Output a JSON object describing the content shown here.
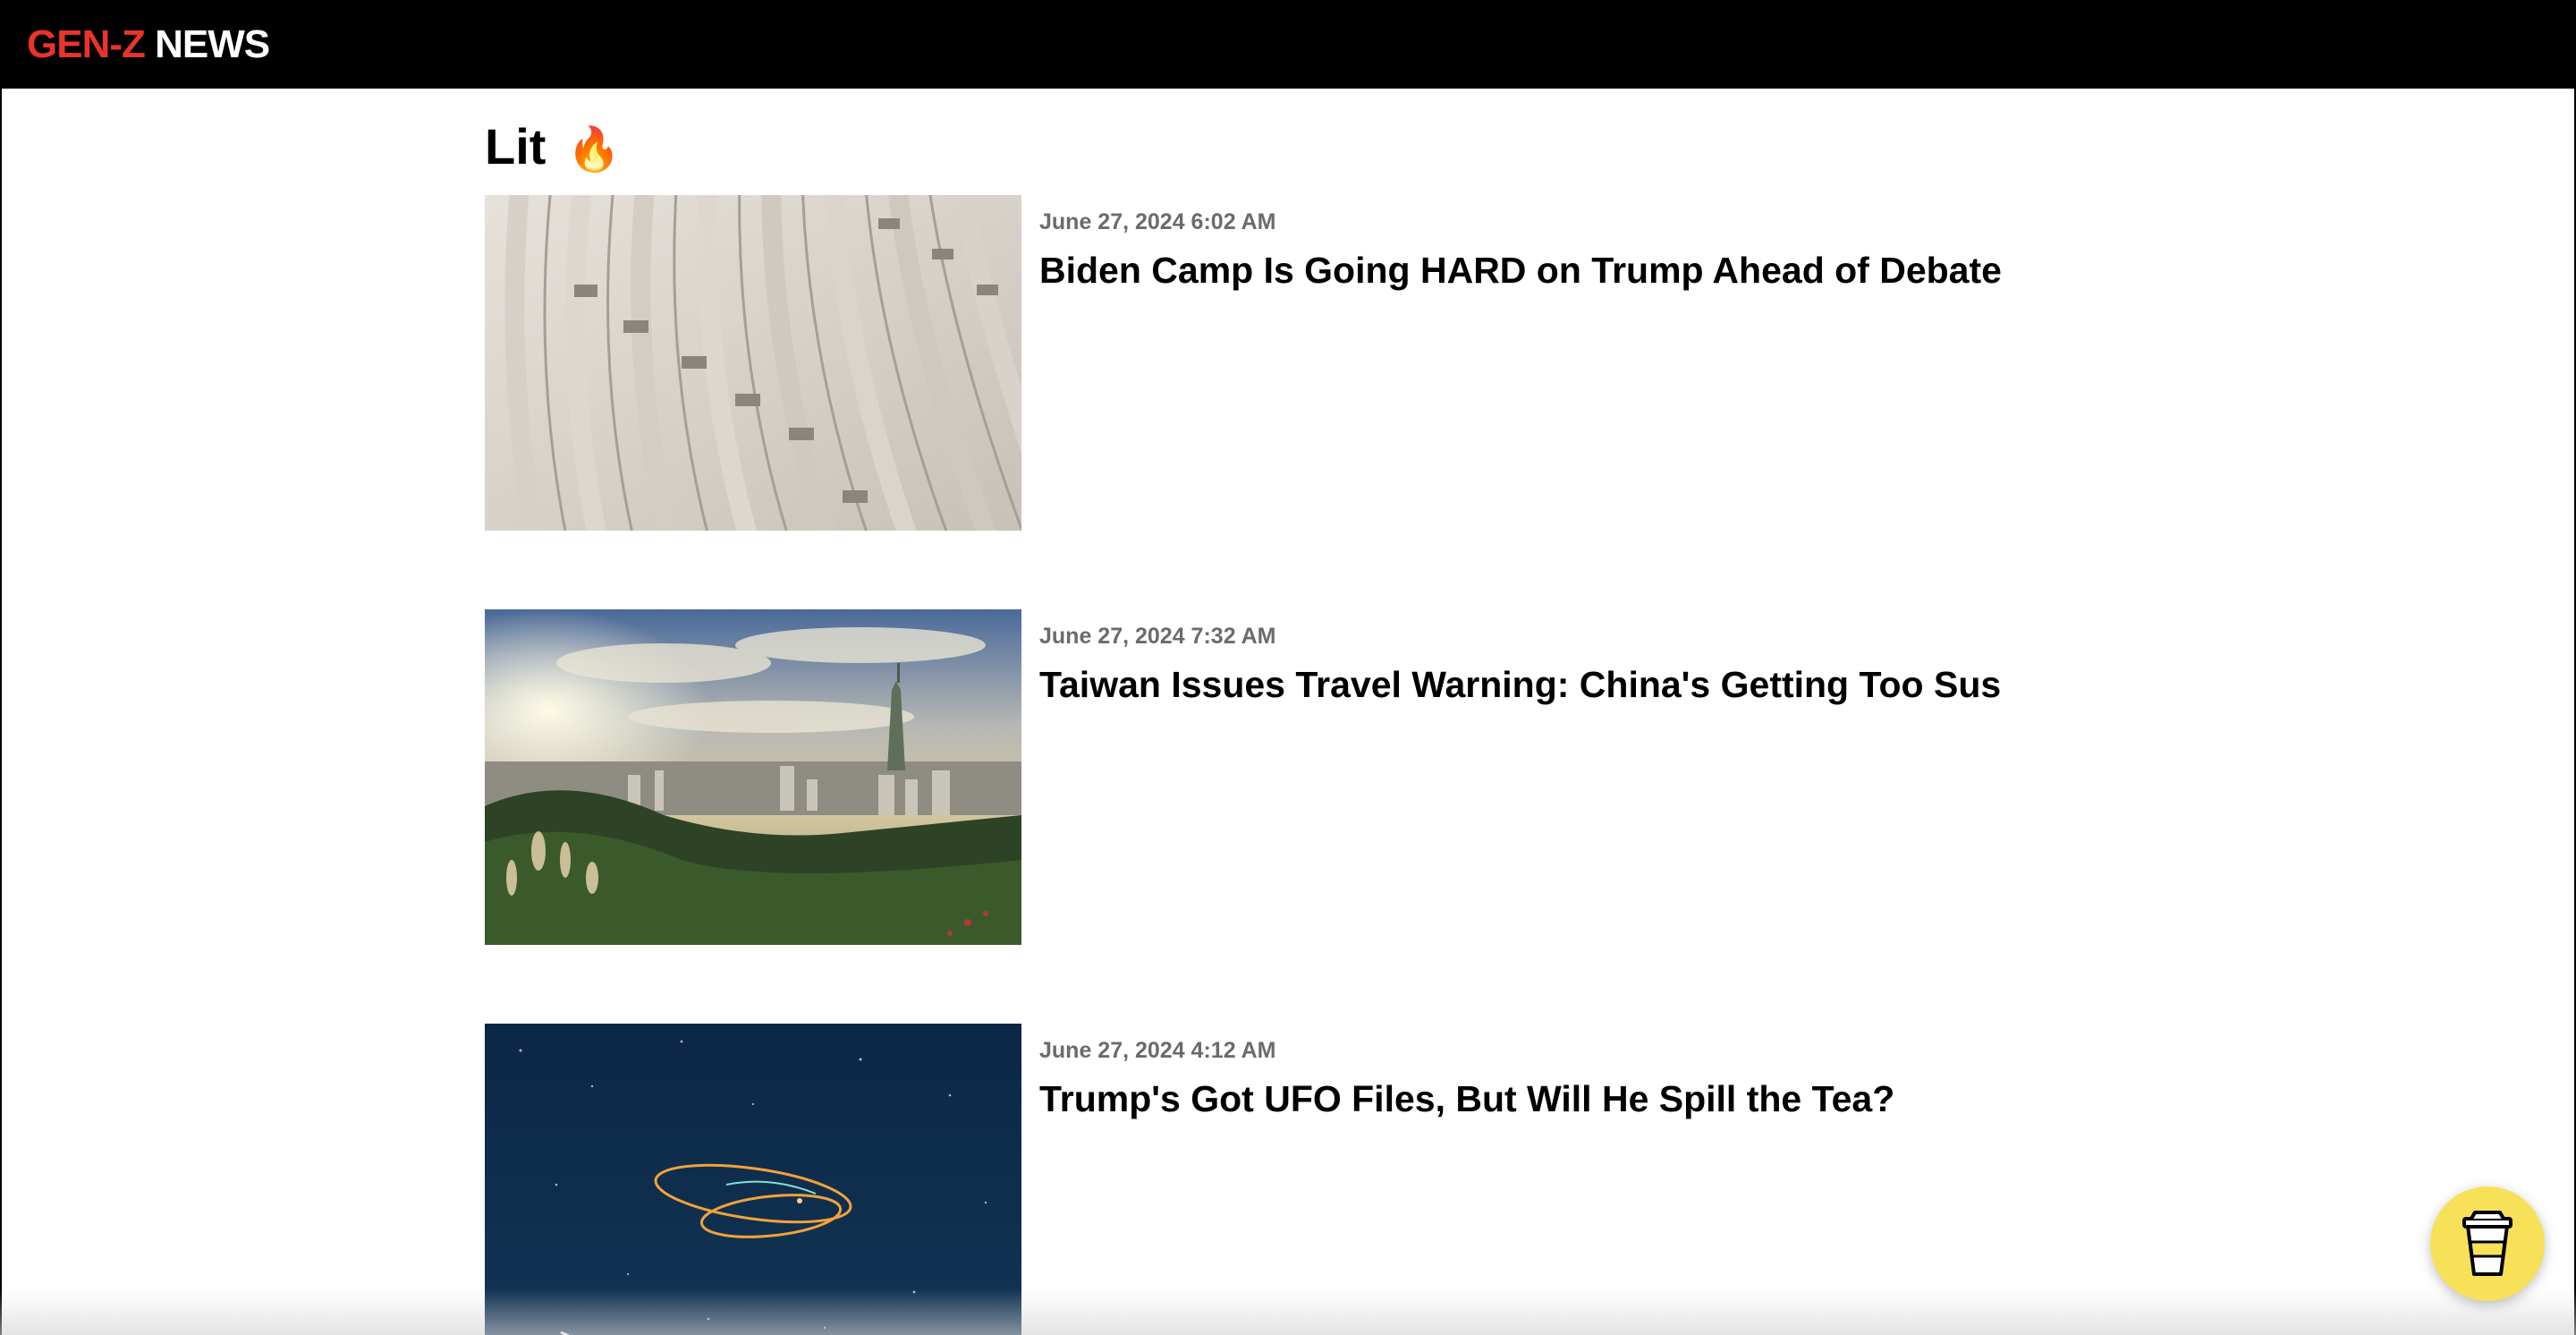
{
  "header": {
    "logo_red": "GEN-Z",
    "logo_white": "NEWS"
  },
  "section": {
    "title": "Lit",
    "emoji": "🔥"
  },
  "articles": [
    {
      "date": "June 27, 2024 6:02 AM",
      "headline": "Biden Camp Is Going HARD on Trump Ahead of Debate",
      "image": "stadium-seating-image"
    },
    {
      "date": "June 27, 2024 7:32 AM",
      "headline": "Taiwan Issues Travel Warning: China's Getting Too Sus",
      "image": "taipei-skyline-image"
    },
    {
      "date": "June 27, 2024 4:12 AM",
      "headline": "Trump's Got UFO Files, But Will He Spill the Tea?",
      "image": "night-sky-light-trail-image"
    }
  ],
  "floating": {
    "icon": "coffee-cup-icon",
    "color": "#f7e159"
  },
  "colors": {
    "brand_red": "#e8342a",
    "topbar": "#000000"
  }
}
